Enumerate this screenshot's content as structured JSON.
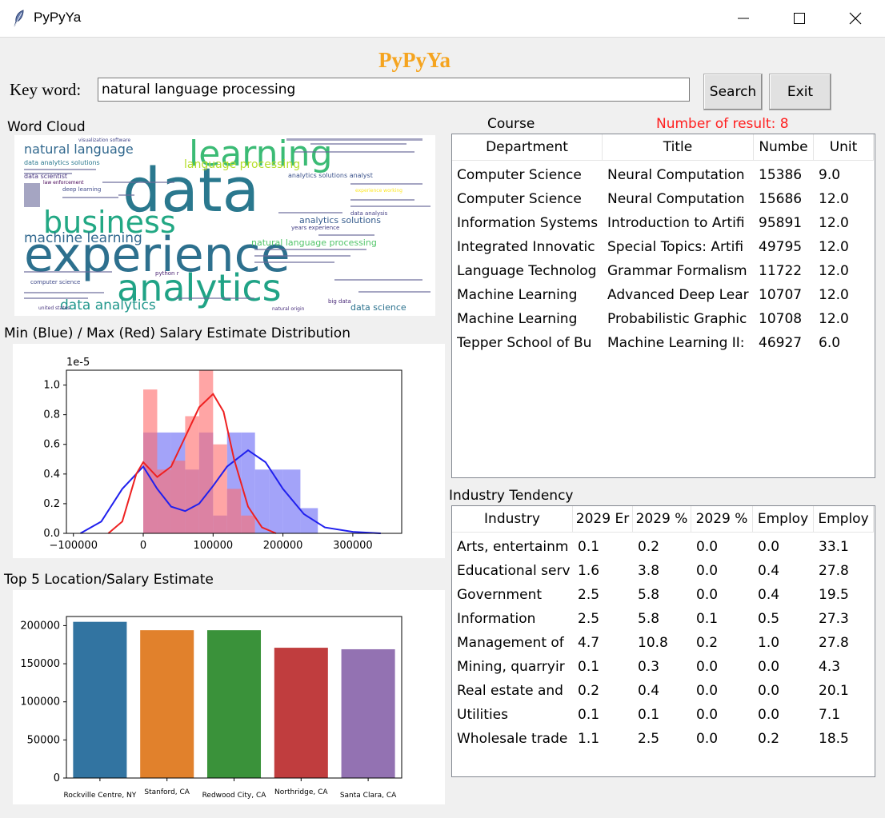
{
  "window": {
    "title": "PyPyYa"
  },
  "app": {
    "title": "PyPyYa"
  },
  "search": {
    "label": "Key word:",
    "value": "natural language processing",
    "search_btn": "Search",
    "exit_btn": "Exit"
  },
  "labels": {
    "wordcloud": "Word Cloud",
    "salary_dist": "Min (Blue) / Max (Red) Salary Estimate Distribution",
    "top5": "Top 5 Location/Salary Estimate",
    "course": "Course",
    "result_count": "Number of result: 8",
    "industry": "Industry Tendency"
  },
  "colors": {
    "accent_title": "#f5a41f",
    "result_count": "#ff2020"
  },
  "wordcloud": {
    "words": [
      {
        "text": "data"
      },
      {
        "text": "experience"
      },
      {
        "text": "analytics"
      },
      {
        "text": "learning"
      },
      {
        "text": "business"
      },
      {
        "text": "natural language"
      },
      {
        "text": "machine learning"
      },
      {
        "text": "data analytics"
      },
      {
        "text": "language processing"
      },
      {
        "text": "natural language processing"
      },
      {
        "text": "data science"
      },
      {
        "text": "analytics solutions"
      },
      {
        "text": "data analytics solutions"
      },
      {
        "text": "data scientist"
      },
      {
        "text": "deep learning"
      },
      {
        "text": "analytics solutions analyst"
      },
      {
        "text": "big data"
      },
      {
        "text": "computer science"
      },
      {
        "text": "data analysis"
      },
      {
        "text": "years experience"
      },
      {
        "text": "visualization software"
      },
      {
        "text": "law enforcement"
      },
      {
        "text": "python r"
      },
      {
        "text": "united states"
      },
      {
        "text": "natural origin"
      },
      {
        "text": "experience working"
      }
    ]
  },
  "course_table": {
    "columns": [
      "Department",
      "Title",
      "Numbe",
      "Unit"
    ],
    "rows": [
      [
        "Computer Science",
        "Neural Computation",
        "15386",
        "9.0"
      ],
      [
        "Computer Science",
        "Neural Computation",
        "15686",
        "12.0"
      ],
      [
        "Information Systems",
        "Introduction to Artifi",
        "95891",
        "12.0"
      ],
      [
        "Integrated Innovatic",
        "Special Topics: Artifi",
        "49795",
        "12.0"
      ],
      [
        "Language Technolog",
        "Grammar Formalism",
        "11722",
        "12.0"
      ],
      [
        "Machine Learning",
        "Advanced Deep Lear",
        "10707",
        "12.0"
      ],
      [
        "Machine Learning",
        "Probabilistic Graphic",
        "10708",
        "12.0"
      ],
      [
        "Tepper School of Bu",
        "Machine Learning II:",
        "46927",
        "6.0"
      ]
    ]
  },
  "industry_table": {
    "columns": [
      "Industry",
      "2029 Er",
      "2029 %",
      "2029 %",
      "Employ",
      "Employ"
    ],
    "rows": [
      [
        "Arts, entertainm",
        "0.1",
        "0.2",
        "0.0",
        "0.0",
        "33.1"
      ],
      [
        "Educational serv",
        "1.6",
        "3.8",
        "0.0",
        "0.4",
        "27.8"
      ],
      [
        "Government",
        "2.5",
        "5.8",
        "0.0",
        "0.4",
        "19.5"
      ],
      [
        "Information",
        "2.5",
        "5.8",
        "0.1",
        "0.5",
        "27.3"
      ],
      [
        "Management of",
        "4.7",
        "10.8",
        "0.2",
        "1.0",
        "27.8"
      ],
      [
        "Mining, quarryir",
        "0.1",
        "0.3",
        "0.0",
        "0.0",
        "4.3"
      ],
      [
        "Real estate and",
        "0.2",
        "0.4",
        "0.0",
        "0.0",
        "20.1"
      ],
      [
        "Utilities",
        "0.1",
        "0.1",
        "0.0",
        "0.0",
        "7.1"
      ],
      [
        "Wholesale trade",
        "1.1",
        "2.5",
        "0.0",
        "0.2",
        "18.5"
      ]
    ]
  },
  "chart_data": [
    {
      "type": "histogram",
      "title": "",
      "offset_label": "1e-5",
      "x_ticks": [
        "−100000",
        "0",
        "100000",
        "200000",
        "300000"
      ],
      "y_ticks": [
        "0.0",
        "0.2",
        "0.4",
        "0.6",
        "0.8",
        "1.0"
      ],
      "xlim": [
        -110000,
        370000
      ],
      "ylim": [
        0,
        1.1
      ],
      "y_scale": 1e-05,
      "bin_edges": [
        0,
        20000,
        40000,
        60000,
        80000,
        100000,
        120000,
        140000,
        160000,
        180000,
        200000,
        225000,
        250000
      ],
      "series": [
        {
          "name": "Min",
          "color": "#6666ff",
          "values": [
            0.68,
            0.68,
            0.68,
            0.43,
            0.68,
            0.12,
            0.68,
            0.68,
            0.43,
            0.43,
            0.43,
            0.17
          ],
          "kde": [
            [
              -90000,
              0.0
            ],
            [
              -60000,
              0.08
            ],
            [
              -30000,
              0.3
            ],
            [
              0,
              0.45
            ],
            [
              20000,
              0.3
            ],
            [
              40000,
              0.18
            ],
            [
              60000,
              0.15
            ],
            [
              80000,
              0.2
            ],
            [
              100000,
              0.32
            ],
            [
              120000,
              0.45
            ],
            [
              150000,
              0.56
            ],
            [
              175000,
              0.48
            ],
            [
              200000,
              0.3
            ],
            [
              230000,
              0.13
            ],
            [
              260000,
              0.04
            ],
            [
              300000,
              0.01
            ],
            [
              340000,
              0.0
            ]
          ]
        },
        {
          "name": "Max",
          "color": "#ff7a7a",
          "values": [
            0.97,
            0.43,
            0.49,
            0.79,
            1.1,
            0.6,
            0.3,
            0.12,
            0.0,
            0.0,
            0.0,
            0.0
          ],
          "kde": [
            [
              -50000,
              0.0
            ],
            [
              -30000,
              0.08
            ],
            [
              -10000,
              0.4
            ],
            [
              0,
              0.48
            ],
            [
              20000,
              0.38
            ],
            [
              40000,
              0.45
            ],
            [
              60000,
              0.65
            ],
            [
              80000,
              0.85
            ],
            [
              100000,
              0.94
            ],
            [
              115000,
              0.82
            ],
            [
              130000,
              0.5
            ],
            [
              150000,
              0.18
            ],
            [
              170000,
              0.04
            ],
            [
              190000,
              0.0
            ]
          ]
        }
      ]
    },
    {
      "type": "bar",
      "title": "",
      "categories": [
        "Rockville Centre, NY",
        "Stanford, CA",
        "Redwood City, CA",
        "Northridge, CA",
        "Santa Clara, CA"
      ],
      "values": [
        205000,
        194000,
        194000,
        171000,
        169000
      ],
      "colors": [
        "#3274a1",
        "#e1812c",
        "#3a923a",
        "#c03d3e",
        "#9372b2"
      ],
      "y_ticks": [
        "0",
        "50000",
        "100000",
        "150000",
        "200000"
      ],
      "ylim": [
        0,
        212000
      ]
    }
  ]
}
